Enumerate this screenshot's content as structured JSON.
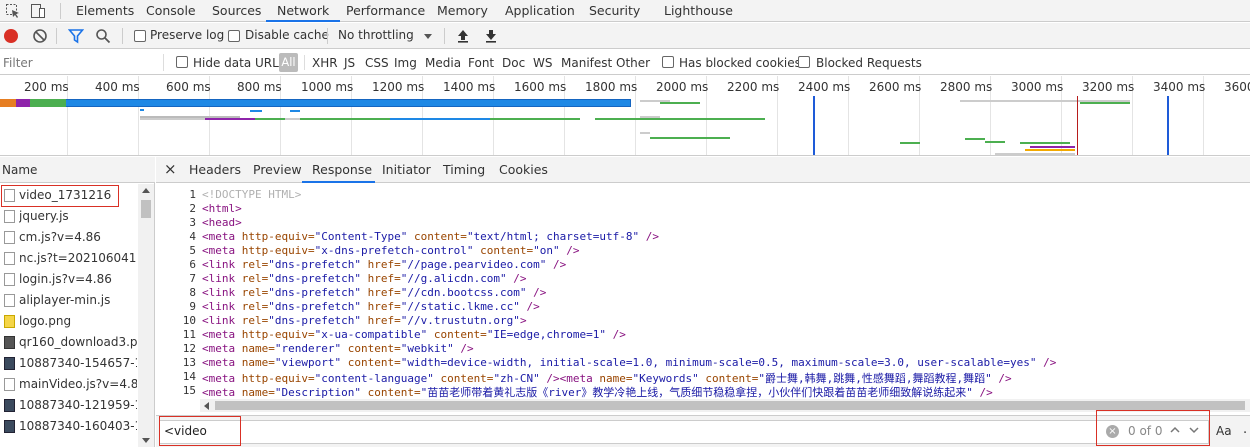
{
  "devtools_tabs": [
    "Elements",
    "Console",
    "Sources",
    "Network",
    "Performance",
    "Memory",
    "Application",
    "Security",
    "Lighthouse"
  ],
  "active_tab": "Network",
  "toolbar": {
    "preserve_log": "Preserve log",
    "disable_cache": "Disable cache",
    "throttling": "No throttling"
  },
  "filter": {
    "placeholder": "Filter",
    "hide_data_urls": "Hide data URLs",
    "types": [
      "All",
      "XHR",
      "JS",
      "CSS",
      "Img",
      "Media",
      "Font",
      "Doc",
      "WS",
      "Manifest",
      "Other"
    ],
    "has_blocked_cookies": "Has blocked cookies",
    "blocked_requests": "Blocked Requests"
  },
  "timeline": {
    "ticks": [
      "200 ms",
      "400 ms",
      "600 ms",
      "800 ms",
      "1000 ms",
      "1200 ms",
      "1400 ms",
      "1600 ms",
      "1800 ms",
      "2000 ms",
      "2200 ms",
      "2400 ms",
      "2600 ms",
      "2800 ms",
      "3000 ms",
      "3200 ms",
      "3400 ms",
      "3600"
    ]
  },
  "list": {
    "header": "Name",
    "items": [
      {
        "name": "video_1731216",
        "icon": "doc"
      },
      {
        "name": "jquery.js",
        "icon": "doc"
      },
      {
        "name": "cm.js?v=4.86",
        "icon": "doc"
      },
      {
        "name": "nc.js?t=2021060418",
        "icon": "doc"
      },
      {
        "name": "login.js?v=4.86",
        "icon": "doc"
      },
      {
        "name": "aliplayer-min.js",
        "icon": "doc"
      },
      {
        "name": "logo.png",
        "icon": "image-yellow"
      },
      {
        "name": "qr160_download3.png",
        "icon": "image-qr"
      },
      {
        "name": "10887340-154657-1.pn",
        "icon": "image-dark"
      },
      {
        "name": "mainVideo.js?v=4.86",
        "icon": "doc"
      },
      {
        "name": "10887340-121959-1.pn",
        "icon": "image-dark"
      },
      {
        "name": "10887340-160403-1.pn",
        "icon": "image-dark"
      }
    ]
  },
  "detail": {
    "close": "×",
    "tabs": [
      "Headers",
      "Preview",
      "Response",
      "Initiator",
      "Timing",
      "Cookies"
    ],
    "active": "Response"
  },
  "code_lines": [
    {
      "n": "1",
      "parts": [
        [
          "doc",
          "<!DOCTYPE HTML>"
        ]
      ]
    },
    {
      "n": "2",
      "parts": [
        [
          "tag",
          "<html>"
        ]
      ]
    },
    {
      "n": "3",
      "parts": [
        [
          "tag",
          "<head>"
        ]
      ]
    },
    {
      "n": "4",
      "parts": [
        [
          "tag",
          "<meta "
        ],
        [
          "attr",
          "http-equiv="
        ],
        [
          "val",
          "\"Content-Type\""
        ],
        [
          "attr",
          " content="
        ],
        [
          "val",
          "\"text/html; charset=utf-8\""
        ],
        [
          "tag",
          " />"
        ]
      ]
    },
    {
      "n": "5",
      "parts": [
        [
          "tag",
          "<meta "
        ],
        [
          "attr",
          "http-equiv="
        ],
        [
          "val",
          "\"x-dns-prefetch-control\""
        ],
        [
          "attr",
          " content="
        ],
        [
          "val",
          "\"on\""
        ],
        [
          "tag",
          " />"
        ]
      ]
    },
    {
      "n": "6",
      "parts": [
        [
          "tag",
          "<link "
        ],
        [
          "attr",
          "rel="
        ],
        [
          "val",
          "\"dns-prefetch\""
        ],
        [
          "attr",
          " href="
        ],
        [
          "val",
          "\"//page.pearvideo.com\""
        ],
        [
          "tag",
          " />"
        ]
      ]
    },
    {
      "n": "7",
      "parts": [
        [
          "tag",
          "<link "
        ],
        [
          "attr",
          "rel="
        ],
        [
          "val",
          "\"dns-prefetch\""
        ],
        [
          "attr",
          " href="
        ],
        [
          "val",
          "\"//g.alicdn.com\""
        ],
        [
          "tag",
          " />"
        ]
      ]
    },
    {
      "n": "8",
      "parts": [
        [
          "tag",
          "<link "
        ],
        [
          "attr",
          "rel="
        ],
        [
          "val",
          "\"dns-prefetch\""
        ],
        [
          "attr",
          " href="
        ],
        [
          "val",
          "\"//cdn.bootcss.com\""
        ],
        [
          "tag",
          " />"
        ]
      ]
    },
    {
      "n": "9",
      "parts": [
        [
          "tag",
          "<link "
        ],
        [
          "attr",
          "rel="
        ],
        [
          "val",
          "\"dns-prefetch\""
        ],
        [
          "attr",
          " href="
        ],
        [
          "val",
          "\"//static.lkme.cc\""
        ],
        [
          "tag",
          " />"
        ]
      ]
    },
    {
      "n": "10",
      "parts": [
        [
          "tag",
          "<link "
        ],
        [
          "attr",
          "rel="
        ],
        [
          "val",
          "\"dns-prefetch\""
        ],
        [
          "attr",
          " href="
        ],
        [
          "val",
          "\"//v.trustutn.org\""
        ],
        [
          "tag",
          ">"
        ]
      ]
    },
    {
      "n": "11",
      "parts": [
        [
          "tag",
          "<meta "
        ],
        [
          "attr",
          "http-equiv="
        ],
        [
          "val",
          "\"x-ua-compatible\""
        ],
        [
          "attr",
          " content="
        ],
        [
          "val",
          "\"IE=edge,chrome=1\""
        ],
        [
          "tag",
          " />"
        ]
      ]
    },
    {
      "n": "12",
      "parts": [
        [
          "tag",
          "<meta "
        ],
        [
          "attr",
          "name="
        ],
        [
          "val",
          "\"renderer\""
        ],
        [
          "attr",
          " content="
        ],
        [
          "val",
          "\"webkit\""
        ],
        [
          "tag",
          " />"
        ]
      ]
    },
    {
      "n": "13",
      "parts": [
        [
          "tag",
          "<meta "
        ],
        [
          "attr",
          "name="
        ],
        [
          "val",
          "\"viewport\""
        ],
        [
          "attr",
          " content="
        ],
        [
          "val",
          "\"width=device-width, initial-scale=1.0, minimum-scale=0.5, maximum-scale=3.0, user-scalable=yes\""
        ],
        [
          "tag",
          " />"
        ]
      ]
    },
    {
      "n": "14",
      "parts": [
        [
          "tag",
          "<meta "
        ],
        [
          "attr",
          "http-equiv="
        ],
        [
          "val",
          "\"content-language\""
        ],
        [
          "attr",
          " content="
        ],
        [
          "val",
          "\"zh-CN\""
        ],
        [
          "tag",
          " /><meta "
        ],
        [
          "attr",
          "name="
        ],
        [
          "val",
          "\"Keywords\""
        ],
        [
          "attr",
          " content="
        ],
        [
          "val",
          "\"爵士舞,韩舞,跳舞,性感舞蹈,舞蹈教程,舞蹈\""
        ],
        [
          "tag",
          " />"
        ]
      ]
    },
    {
      "n": "15",
      "parts": [
        [
          "tag",
          "<meta "
        ],
        [
          "attr",
          "name="
        ],
        [
          "val",
          "\"Description\""
        ],
        [
          "attr",
          " content="
        ],
        [
          "val",
          "\"苗苗老师带着黄礼志版《river》教学冷艳上线，气质细节稳稳拿捏，小伙伴们快跟着苗苗老师细致解说练起来\""
        ],
        [
          "tag",
          " />"
        ]
      ]
    }
  ],
  "search": {
    "value": "<video",
    "count": "0 of 0",
    "match_case": "Aa"
  }
}
